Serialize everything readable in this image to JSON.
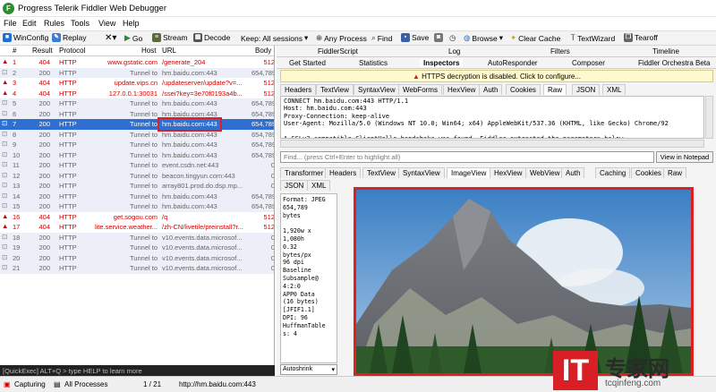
{
  "app": {
    "title": "Progress Telerik Fiddler Web Debugger",
    "logo_letter": "F",
    "accent": "#2e8b2e"
  },
  "menu": [
    "File",
    "Edit",
    "Rules",
    "Tools",
    "View",
    "Help"
  ],
  "toolbar": {
    "winconfig": "WinConfig",
    "replay": "Replay",
    "go": "Go",
    "stream": "Stream",
    "decode": "Decode",
    "keep": "Keep: All sessions",
    "any_process": "Any Process",
    "find": "Find",
    "save": "Save",
    "browse": "Browse",
    "clear_cache": "Clear Cache",
    "textwizard": "TextWizard",
    "tearoff": "Tearoff"
  },
  "sessions": {
    "headers": [
      "#",
      "Result",
      "Protocol",
      "Host",
      "URL",
      "Body"
    ],
    "rows": [
      {
        "num": "1",
        "result": "404",
        "protocol": "HTTP",
        "host": "www.gstatic.com",
        "url": "/generate_204",
        "body": "512",
        "style": "error"
      },
      {
        "num": "2",
        "result": "200",
        "protocol": "HTTP",
        "host": "Tunnel to",
        "url": "hm.baidu.com:443",
        "body": "654,789",
        "style": "tunnel"
      },
      {
        "num": "3",
        "result": "404",
        "protocol": "HTTP",
        "host": "update.vips.cn",
        "url": "/updateserver/update?v=...",
        "body": "512",
        "style": "error"
      },
      {
        "num": "4",
        "result": "404",
        "protocol": "HTTP",
        "host": "127.0.0.1:30031",
        "url": "/ssei?key=3e70f0193a4b...",
        "body": "512",
        "style": "error"
      },
      {
        "num": "5",
        "result": "200",
        "protocol": "HTTP",
        "host": "Tunnel to",
        "url": "hm.baidu.com:443",
        "body": "654,789",
        "style": "tunnel"
      },
      {
        "num": "6",
        "result": "200",
        "protocol": "HTTP",
        "host": "Tunnel to",
        "url": "hm.baidu.com:443",
        "body": "654,789",
        "style": "tunnel"
      },
      {
        "num": "7",
        "result": "200",
        "protocol": "HTTP",
        "host": "Tunnel to",
        "url": "hm.baidu.com:443",
        "body": "654,789",
        "style": "selected"
      },
      {
        "num": "8",
        "result": "200",
        "protocol": "HTTP",
        "host": "Tunnel to",
        "url": "hm.baidu.com:443",
        "body": "654,789",
        "style": "tunnel"
      },
      {
        "num": "9",
        "result": "200",
        "protocol": "HTTP",
        "host": "Tunnel to",
        "url": "hm.baidu.com:443",
        "body": "654,789",
        "style": "tunnel"
      },
      {
        "num": "10",
        "result": "200",
        "protocol": "HTTP",
        "host": "Tunnel to",
        "url": "hm.baidu.com:443",
        "body": "654,789",
        "style": "tunnel"
      },
      {
        "num": "11",
        "result": "200",
        "protocol": "HTTP",
        "host": "Tunnel to",
        "url": "event.csdn.net:443",
        "body": "0",
        "style": "tunnel"
      },
      {
        "num": "12",
        "result": "200",
        "protocol": "HTTP",
        "host": "Tunnel to",
        "url": "beacon.tingyun.com:443",
        "body": "0",
        "style": "tunnel"
      },
      {
        "num": "13",
        "result": "200",
        "protocol": "HTTP",
        "host": "Tunnel to",
        "url": "array801.prod.do.dsp.mp...",
        "body": "0",
        "style": "tunnel"
      },
      {
        "num": "14",
        "result": "200",
        "protocol": "HTTP",
        "host": "Tunnel to",
        "url": "hm.baidu.com:443",
        "body": "654,789",
        "style": "tunnel"
      },
      {
        "num": "15",
        "result": "200",
        "protocol": "HTTP",
        "host": "Tunnel to",
        "url": "hm.baidu.com:443",
        "body": "654,789",
        "style": "tunnel"
      },
      {
        "num": "16",
        "result": "404",
        "protocol": "HTTP",
        "host": "get.sogou.com",
        "url": "/q",
        "body": "512",
        "style": "error"
      },
      {
        "num": "17",
        "result": "404",
        "protocol": "HTTP",
        "host": "lite.service.weather...",
        "url": "/zh-CN/livetile/preinstall?r...",
        "body": "512",
        "style": "error"
      },
      {
        "num": "18",
        "result": "200",
        "protocol": "HTTP",
        "host": "Tunnel to",
        "url": "v10.events.data.microsof...",
        "body": "0",
        "style": "tunnel"
      },
      {
        "num": "19",
        "result": "200",
        "protocol": "HTTP",
        "host": "Tunnel to",
        "url": "v10.events.data.microsof...",
        "body": "0",
        "style": "tunnel"
      },
      {
        "num": "20",
        "result": "200",
        "protocol": "HTTP",
        "host": "Tunnel to",
        "url": "v10.events.data.microsof...",
        "body": "0",
        "style": "tunnel"
      },
      {
        "num": "21",
        "result": "200",
        "protocol": "HTTP",
        "host": "Tunnel to",
        "url": "v10.events.data.microsof...",
        "body": "0",
        "style": "tunnel"
      }
    ]
  },
  "quickexec": "[QuickExec] ALT+Q > type HELP to learn more",
  "status": {
    "capturing": "Capturing",
    "processes": "All Processes",
    "count": "1 / 21",
    "url": "http://hm.baidu.com:443"
  },
  "inspector": {
    "top_tabs_row1": [
      "FiddlerScript",
      "Log",
      "Filters",
      "Timeline"
    ],
    "top_tabs_row2": [
      "Get Started",
      "Statistics",
      "Inspectors",
      "AutoResponder",
      "Composer",
      "Fiddler Orchestra Beta"
    ],
    "warning": "HTTPS decryption is disabled. Click to configure...",
    "request_tabs": [
      "Headers",
      "TextView",
      "SyntaxView",
      "WebForms",
      "HexView",
      "Auth",
      "Cookies",
      "Raw",
      "JSON",
      "XML"
    ],
    "request_active": "Raw",
    "request_text": "CONNECT hm.baidu.com:443 HTTP/1.1\nHost: hm.baidu.com:443\nProxy-Connection: keep-alive\nUser-Agent: Mozilla/5.0 (Windows NT 10.0; Win64; x64) AppleWebKit/537.36 (KHTML, like Gecko) Chrome/92\n\nA SSLv3-compatible ClientHello handshake was found. Fiddler extracted the parameters below.",
    "find_placeholder": "Find... (press Ctrl+Enter to highlight all)",
    "view_notepad": "View in Notepad",
    "response_tabs": [
      "Transformer",
      "Headers",
      "TextView",
      "SyntaxView",
      "ImageView",
      "HexView",
      "WebView",
      "Auth",
      "Caching",
      "Cookies",
      "Raw"
    ],
    "response_tabs2": [
      "JSON",
      "XML"
    ],
    "response_active": "ImageView",
    "image_meta": [
      "Format: JPEG",
      "654,789",
      "bytes",
      "",
      "1,920w x",
      "1,080h",
      "0.32",
      "bytes/px",
      "96 dpi",
      "Baseline",
      "Subsample@",
      "4:2:0",
      "APP0 Data",
      "(16 bytes)",
      "[JFIF1.1]",
      "DPI: 96",
      "HuffmanTable",
      "s: 4"
    ],
    "autoshrink": "Autoshrink"
  },
  "watermark": {
    "logo": "IT",
    "name": "专家网",
    "site": "tcqinfeng.com"
  }
}
